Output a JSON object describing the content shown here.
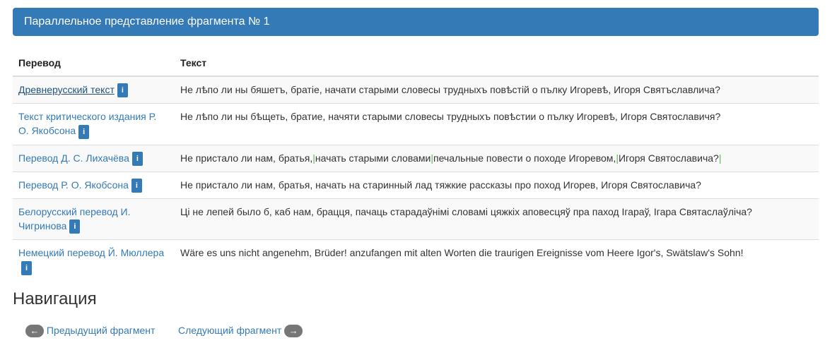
{
  "header": {
    "title": "Параллельное представление фрагмента № 1"
  },
  "table": {
    "col_translation": "Перевод",
    "col_text": "Текст",
    "info_label": "i",
    "rows": [
      {
        "translation": "Древнерусский текст",
        "text": "Не лѣпо ли ны бяшетъ, братіе, начати старыми словесы трудныхъ повѣстій о пълку Игоревѣ, Игоря Святъславлича?"
      },
      {
        "translation": "Текст критического издания Р. О. Якобсона",
        "text": "Не лѣпо ли ны бѣщеть, братие, начяти старыми словесы трудныхъ повѣстии о пълку Игоревѣ, Игоря Святославичя?"
      },
      {
        "translation": "Перевод Д. С. Лихачёва",
        "segments": [
          "Не пристало ли нам, братья,",
          "начать старыми словами",
          "печальные повести о походе Игоревом,",
          "Игоря Святославича?"
        ],
        "separator": "|"
      },
      {
        "translation": "Перевод Р. О. Якобсона",
        "text": "Не пристало ли нам, братья, начать на старинный лад тяжкие рассказы про поход Игорев, Игоря Святославича?"
      },
      {
        "translation": "Белорусский перевод И. Чигринова",
        "text": "Ці не лепей было б, каб нам, брацця, пачаць старадаўнімі словамі цяжкіх аповесцяў пра паход Ігараў, Ігара Святаслаўліча?"
      },
      {
        "translation": "Немецкий перевод Й. Мюллера",
        "text": "Wäre es uns nicht angenehm, Brüder! anzufangen mit alten Worten die traurigen Ereignisse vom Heere Igor's, Swätslaw's Sohn!"
      }
    ]
  },
  "navigation": {
    "title": "Навигация",
    "prev_label": "Предыдущий фрагмент",
    "next_label": "Следующий фрагмент",
    "prev_arrow": "←",
    "next_arrow": "→"
  }
}
